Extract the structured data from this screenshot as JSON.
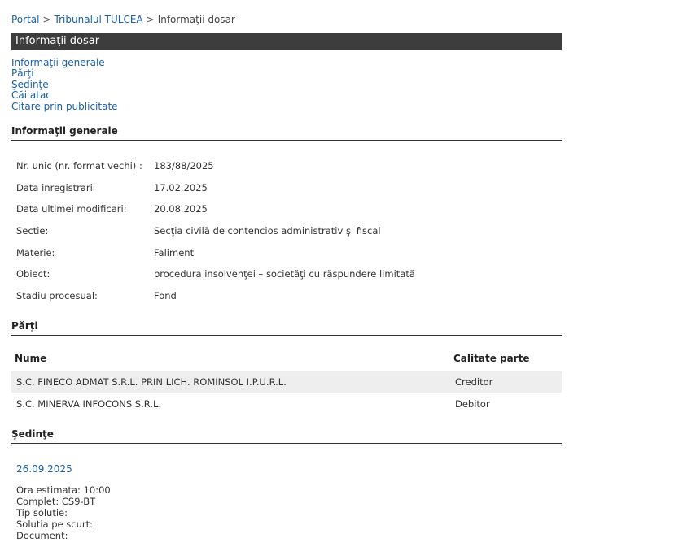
{
  "breadcrumb": {
    "portal": "Portal",
    "sep1": ">",
    "tribunal": "Tribunalul TULCEA",
    "sep2": ">",
    "current": "Informaţii dosar"
  },
  "page_title": "Informaţii dosar",
  "toc": [
    "Informaţii generale",
    "Părţi",
    "Şedinţe",
    "Căi atac",
    "Citare prin publicitate"
  ],
  "general": {
    "heading": "Informaţii generale",
    "rows": [
      {
        "label": "Nr. unic (nr. format vechi) :",
        "value": "183/88/2025"
      },
      {
        "label": "Data inregistrarii",
        "value": "17.02.2025"
      },
      {
        "label": "Data ultimei modificari:",
        "value": "20.08.2025"
      },
      {
        "label": "Sectie:",
        "value": "Secţia civilă de contencios administrativ şi fiscal"
      },
      {
        "label": "Materie:",
        "value": "Faliment"
      },
      {
        "label": "Obiect:",
        "value": "procedura insolvenţei – societăţi cu răspundere limitată"
      },
      {
        "label": "Stadiu procesual:",
        "value": "Fond"
      }
    ]
  },
  "parti": {
    "heading": "Părţi",
    "col_name": "Nume",
    "col_role": "Calitate parte",
    "rows": [
      {
        "name": "S.C. FINECO ADMAT S.R.L. PRIN LICH. ROMINSOL I.P.U.R.L.",
        "role": "Creditor"
      },
      {
        "name": "S.C. MINERVA INFOCONS S.R.L.",
        "role": "Debitor"
      }
    ]
  },
  "sedinte": {
    "heading": "Şedinţe",
    "date": "26.09.2025",
    "details": [
      "Ora estimata: 10:00",
      "Complet: CS9-BT",
      "Tip solutie:",
      "Solutia pe scurt:",
      "Document:"
    ]
  }
}
